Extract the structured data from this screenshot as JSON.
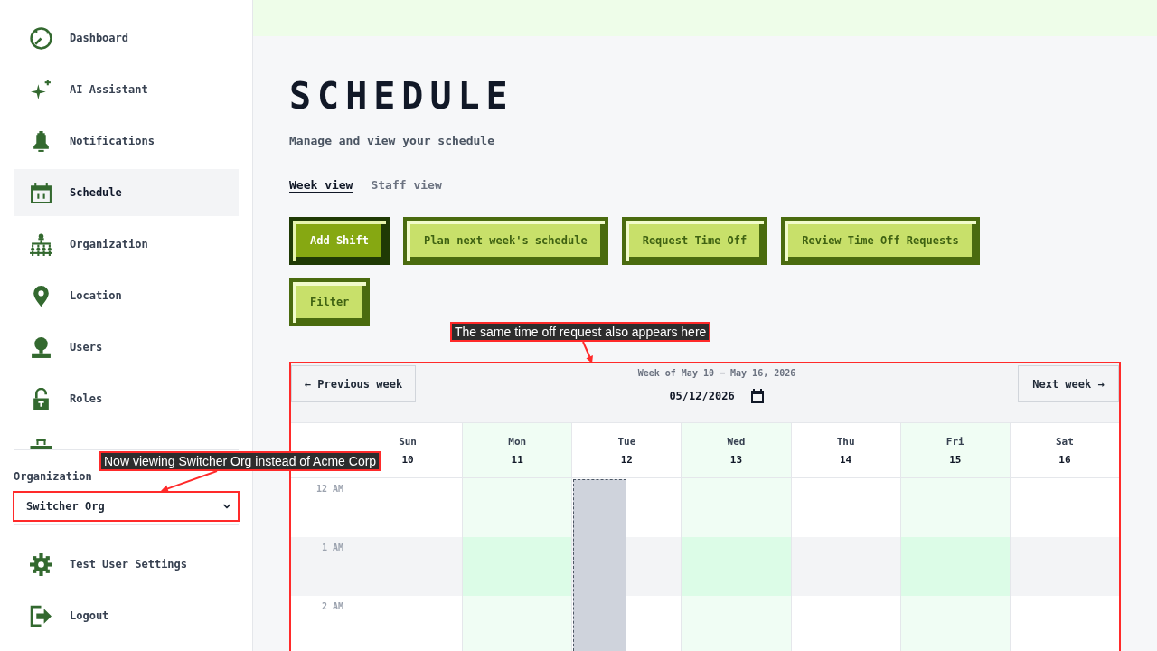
{
  "sidebar": {
    "nav_items": [
      {
        "label": "Dashboard",
        "selected": false
      },
      {
        "label": "AI Assistant",
        "selected": false
      },
      {
        "label": "Notifications",
        "selected": false
      },
      {
        "label": "Schedule",
        "selected": true
      },
      {
        "label": "Organization",
        "selected": false
      },
      {
        "label": "Location",
        "selected": false
      },
      {
        "label": "Users",
        "selected": false
      },
      {
        "label": "Roles",
        "selected": false
      },
      {
        "selected": false
      }
    ],
    "organization": {
      "label": "Organization",
      "value": "Switcher Org",
      "annotation": {
        "text": "Now viewing Switcher Org instead of Acme Corp"
      }
    },
    "account_items": [
      {
        "label": "Test User Settings"
      },
      {
        "label": "Logout"
      }
    ]
  },
  "page": {
    "title": "SCHEDULE",
    "subtitle": "Manage and view your schedule"
  },
  "view_tabs": [
    {
      "label": "Week view",
      "selected": true
    },
    {
      "label": "Staff view",
      "selected": false
    }
  ],
  "actions": [
    {
      "label": "Add Shift",
      "primary": true
    },
    {
      "label": "Plan next week's schedule",
      "primary": false
    },
    {
      "label": "Request Time Off",
      "primary": false
    },
    {
      "label": "Review Time Off Requests",
      "primary": false
    }
  ],
  "filter_button": {
    "label": "Filter"
  },
  "calendar": {
    "previous_button": "← Previous week",
    "week_label": "Week of May 10 – May 16, 2026",
    "date_value": "05/12/2026",
    "next_button": "Next week →",
    "days": [
      {
        "name": "Sun",
        "date": "10",
        "tinted": false,
        "time_off": false
      },
      {
        "name": "Mon",
        "date": "11",
        "tinted": true,
        "time_off": false
      },
      {
        "name": "Tue",
        "date": "12",
        "tinted": false,
        "time_off": true
      },
      {
        "name": "Wed",
        "date": "13",
        "tinted": true,
        "time_off": false
      },
      {
        "name": "Thu",
        "date": "14",
        "tinted": false,
        "time_off": false
      },
      {
        "name": "Fri",
        "date": "15",
        "tinted": true,
        "time_off": false
      },
      {
        "name": "Sat",
        "date": "16",
        "tinted": false,
        "time_off": false
      }
    ],
    "hours": [
      {
        "label": "12 AM",
        "shaded": false
      },
      {
        "label": "1 AM",
        "shaded": true
      },
      {
        "label": "2 AM",
        "shaded": false
      }
    ],
    "annotation": {
      "text": "The same time off request also appears here"
    }
  }
}
